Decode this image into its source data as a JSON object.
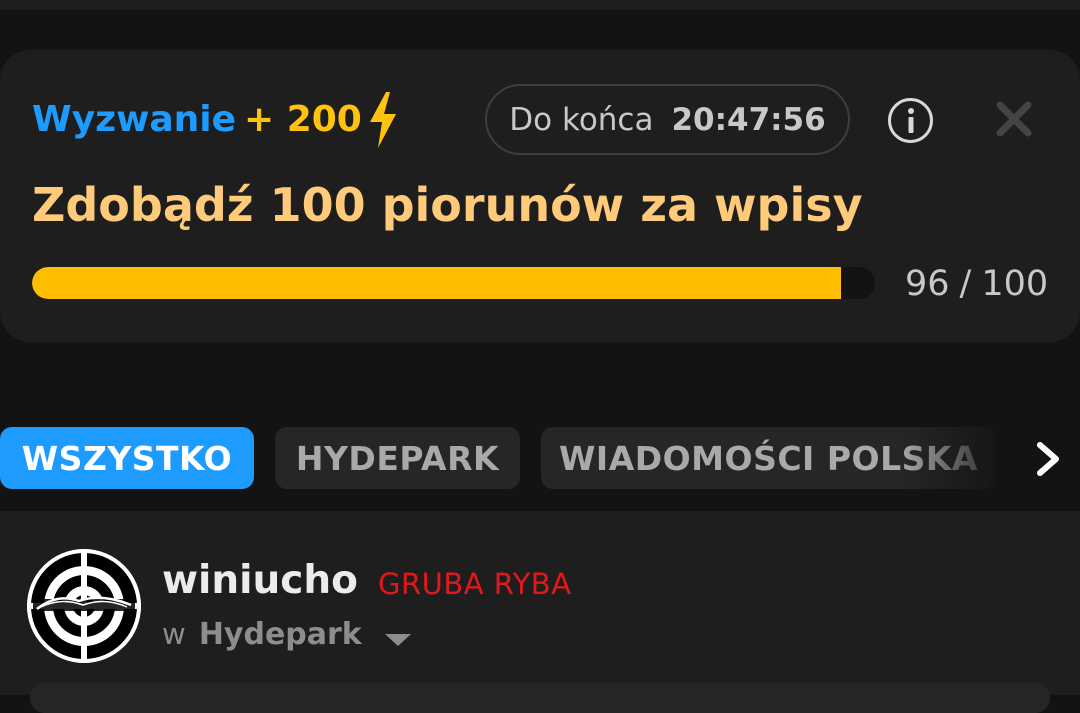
{
  "challenge": {
    "label": "Wyzwanie",
    "reward": "+ 200",
    "reward_icon": "lightning-bolt-icon",
    "timer_label": "Do końca",
    "timer_value": "20:47:56",
    "title": "Zdobądź 100 piorunów za wpisy",
    "progress_current": "96",
    "progress_total": "100",
    "progress_fraction": 0.96,
    "accent_color": "#1e9bff",
    "reward_color": "#ffc20e",
    "bar_color": "#ffbf00"
  },
  "tabs": [
    {
      "label": "WSZYSTKO",
      "active": true
    },
    {
      "label": "HYDEPARK",
      "active": false
    },
    {
      "label": "WIADOMOŚCI POLSKA",
      "active": false
    }
  ],
  "post": {
    "username": "winiucho",
    "rank": "GRUBA RYBA",
    "in_prefix": "w",
    "community": "Hydepark"
  }
}
